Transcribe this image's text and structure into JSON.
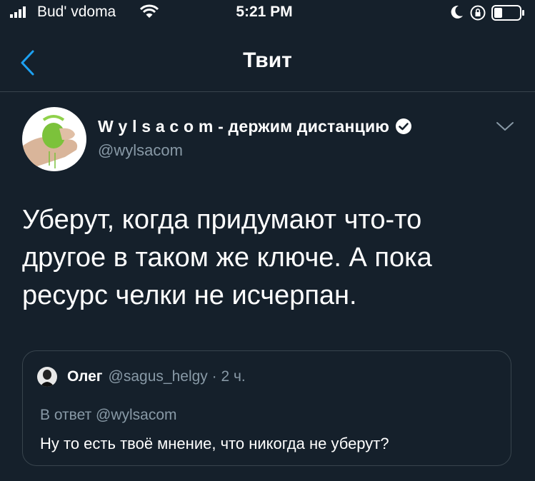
{
  "status": {
    "carrier": "Bud' vdoma",
    "time": "5:21 PM",
    "icons": [
      "signal-icon",
      "wifi-icon",
      "moon-icon",
      "rotation-lock-icon",
      "battery-icon"
    ]
  },
  "nav": {
    "title": "Твит",
    "back_icon": "chevron-left-icon"
  },
  "tweet": {
    "display_name": "W y l s a c o m - держим дистанцию",
    "handle": "@wylsacom",
    "verified": true,
    "text": "Уберут, когда придумают что-то\nдругое в таком же ключе. А пока\nресурс челки не исчерпан."
  },
  "quote": {
    "name": "Олег",
    "meta": "@sagus_helgy · 2 ч.",
    "reply_to": "В ответ @wylsacom",
    "text": "Ну то есть твоё мнение, что никогда не уберут?"
  },
  "colors": {
    "background": "#15202b",
    "accent": "#1da1f2",
    "secondary_text": "#8899a6",
    "border": "#38444d"
  }
}
